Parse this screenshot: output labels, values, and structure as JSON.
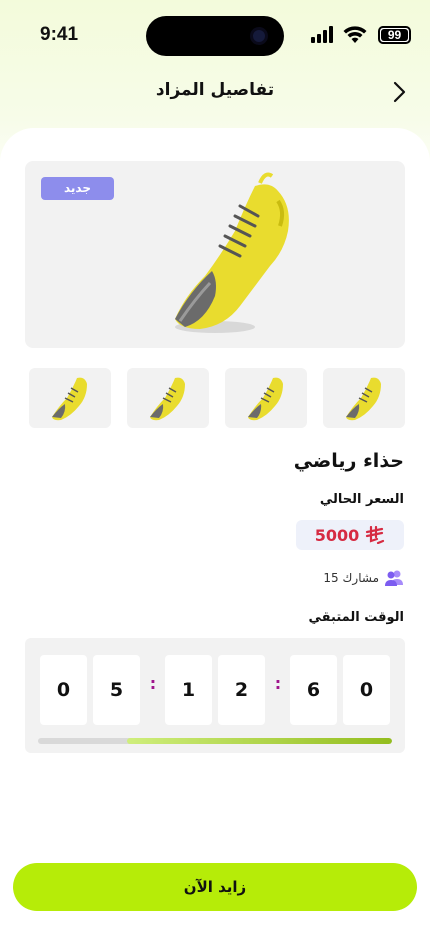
{
  "status_bar": {
    "time": "9:41",
    "battery": "99"
  },
  "header": {
    "title": "تفاصيل المزاد"
  },
  "product": {
    "badge": "جديد",
    "name": "حذاء رياضي",
    "price_label": "السعر الحالي",
    "price": "5000",
    "currency_symbol": "⃁",
    "participants": "15 مشارك",
    "remaining_label": "الوقت المتبقي",
    "accent_color": "#b6ec08"
  },
  "timer": {
    "digits": [
      "0",
      "5",
      "1",
      "2",
      "6",
      "0"
    ],
    "separator": ":",
    "progress_fraction": 0.75
  },
  "actions": {
    "bid_label": "زايد الآن"
  }
}
